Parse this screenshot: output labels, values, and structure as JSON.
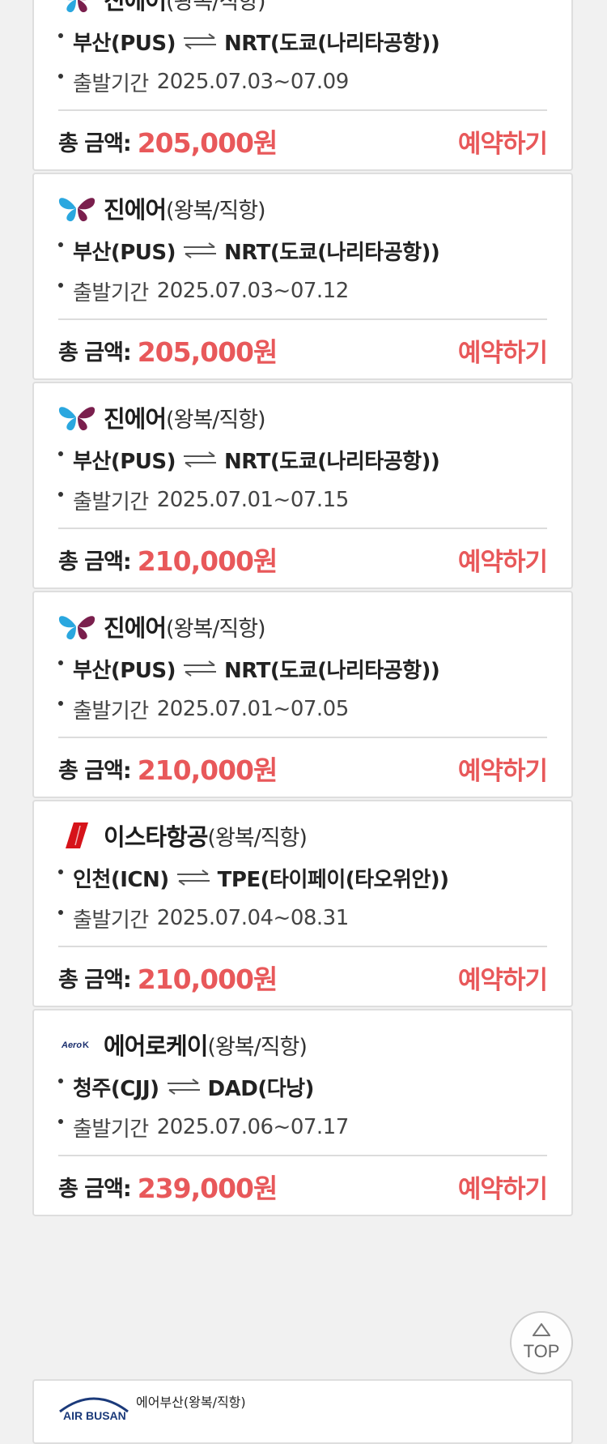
{
  "listings": [
    {
      "airline": "진에어",
      "tag": "(왕복/직항)",
      "logo": "jinair-logo-icon",
      "origin": "부산(PUS)",
      "destination": "NRT(도쿄(나리타공항))",
      "period_label": "출발기간",
      "period": "2025.07.03~07.09",
      "total_label": "총 금액:",
      "price": "205,000원",
      "book_label": "예약하기"
    },
    {
      "airline": "진에어",
      "tag": "(왕복/직항)",
      "logo": "jinair-logo-icon",
      "origin": "부산(PUS)",
      "destination": "NRT(도쿄(나리타공항))",
      "period_label": "출발기간",
      "period": "2025.07.03~07.12",
      "total_label": "총 금액:",
      "price": "205,000원",
      "book_label": "예약하기"
    },
    {
      "airline": "진에어",
      "tag": "(왕복/직항)",
      "logo": "jinair-logo-icon",
      "origin": "부산(PUS)",
      "destination": "NRT(도쿄(나리타공항))",
      "period_label": "출발기간",
      "period": "2025.07.01~07.15",
      "total_label": "총 금액:",
      "price": "210,000원",
      "book_label": "예약하기"
    },
    {
      "airline": "진에어",
      "tag": "(왕복/직항)",
      "logo": "jinair-logo-icon",
      "origin": "부산(PUS)",
      "destination": "NRT(도쿄(나리타공항))",
      "period_label": "출발기간",
      "period": "2025.07.01~07.05",
      "total_label": "총 금액:",
      "price": "210,000원",
      "book_label": "예약하기"
    },
    {
      "airline": "이스타항공",
      "tag": "(왕복/직항)",
      "logo": "eastar-logo-icon",
      "origin": "인천(ICN)",
      "destination": "TPE(타이페이(타오위안))",
      "period_label": "출발기간",
      "period": "2025.07.04~08.31",
      "total_label": "총 금액:",
      "price": "210,000원",
      "book_label": "예약하기"
    },
    {
      "airline": "에어로케이",
      "tag": "(왕복/직항)",
      "logo": "aerok-logo-icon",
      "origin": "청주(CJJ)",
      "destination": "DAD(다낭)",
      "period_label": "출발기간",
      "period": "2025.07.06~07.17",
      "total_label": "총 금액:",
      "price": "239,000원",
      "book_label": "예약하기"
    }
  ],
  "partial": {
    "airline": "에어부산",
    "tag": "(왕복/직항)",
    "logo": "airbusan-logo-icon"
  },
  "top_button": {
    "label": "TOP",
    "icon": "triangle-up-icon"
  },
  "colors": {
    "accent": "#e8585a",
    "background": "#f1f1f1",
    "card": "#ffffff"
  }
}
